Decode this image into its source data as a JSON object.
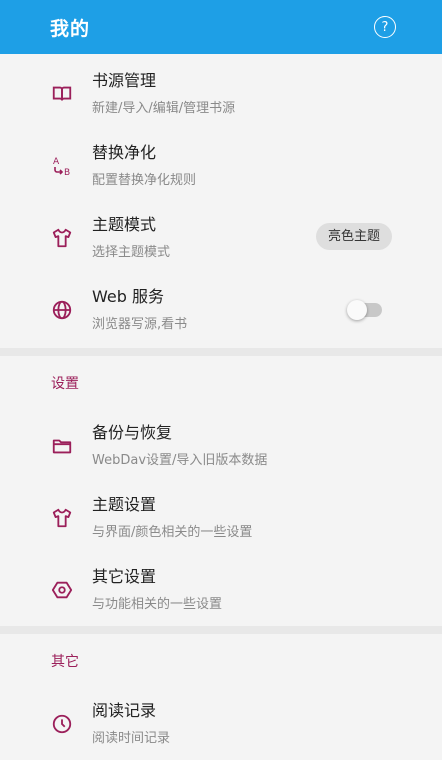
{
  "appbar": {
    "title": "我的",
    "help_icon": "?"
  },
  "items": [
    {
      "title": "书源管理",
      "subtitle": "新建/导入/编辑/管理书源",
      "icon": "book-icon"
    },
    {
      "title": "替换净化",
      "subtitle": "配置替换净化规则",
      "icon": "replace-ab-icon"
    },
    {
      "title": "主题模式",
      "subtitle": "选择主题模式",
      "icon": "shirt-icon",
      "pill": "亮色主题"
    },
    {
      "title": "Web 服务",
      "subtitle": "浏览器写源,看书",
      "icon": "globe-icon",
      "toggle": false
    }
  ],
  "settings": {
    "header": "设置",
    "items": [
      {
        "title": "备份与恢复",
        "subtitle": "WebDav设置/导入旧版本数据",
        "icon": "folder-icon"
      },
      {
        "title": "主题设置",
        "subtitle": "与界面/颜色相关的一些设置",
        "icon": "shirt-icon"
      },
      {
        "title": "其它设置",
        "subtitle": "与功能相关的一些设置",
        "icon": "hexagon-settings-icon"
      }
    ]
  },
  "other": {
    "header": "其它",
    "items": [
      {
        "title": "阅读记录",
        "subtitle": "阅读时间记录",
        "icon": "clock-icon"
      }
    ]
  },
  "colors": {
    "appbar": "#1e9fe6",
    "accent": "#9b1f5a",
    "background": "#f4f4f4"
  }
}
